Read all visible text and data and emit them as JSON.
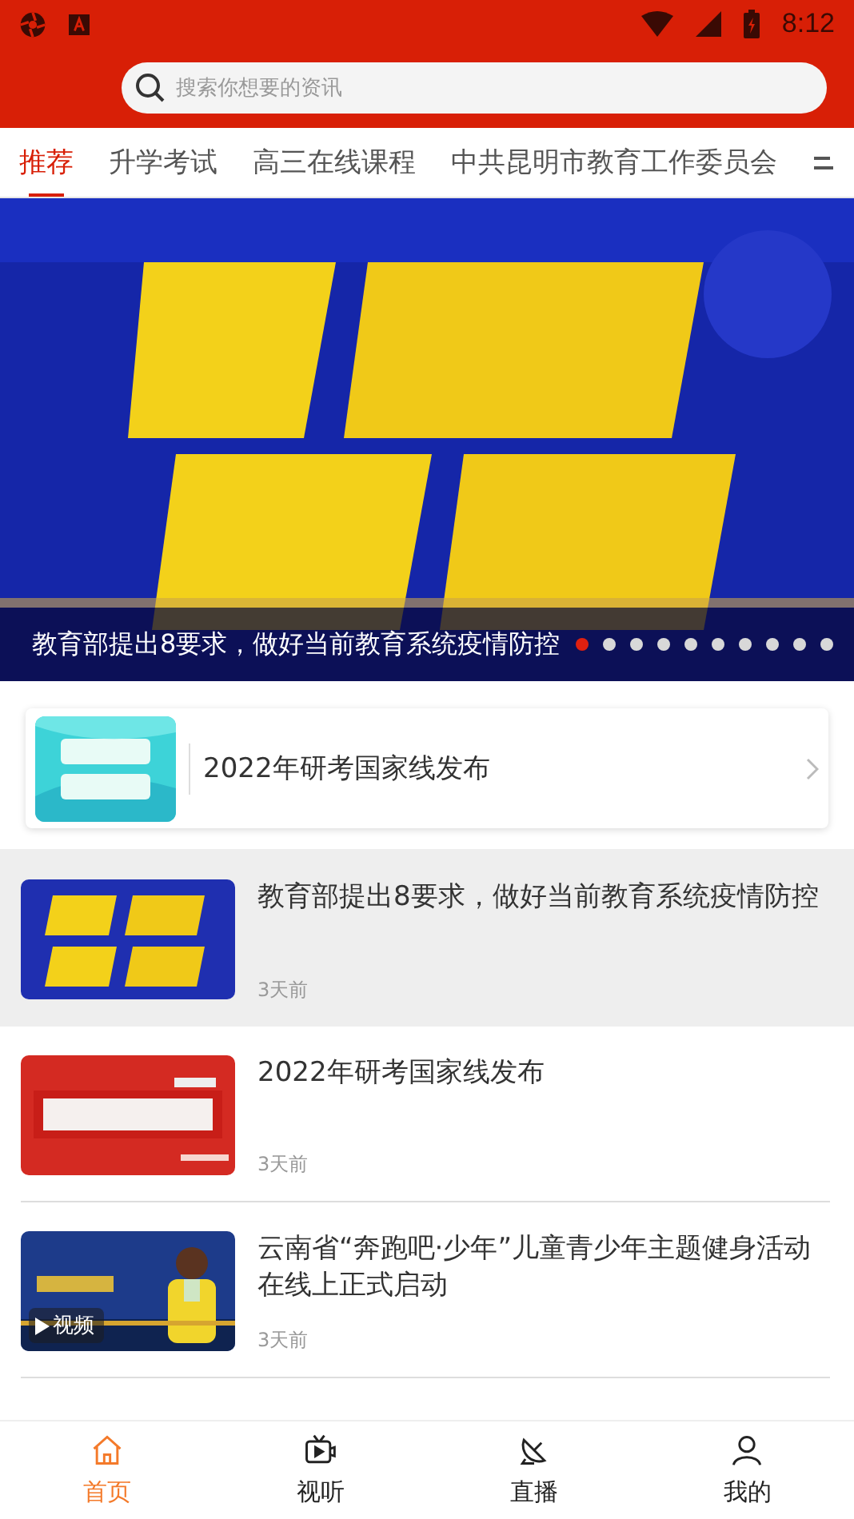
{
  "status_bar": {
    "time": "8:12"
  },
  "search": {
    "placeholder": "搜索你想要的资讯"
  },
  "tabs": [
    {
      "label": "推荐",
      "selected": true
    },
    {
      "label": "升学考试",
      "selected": false
    },
    {
      "label": "高三在线课程",
      "selected": false
    },
    {
      "label": "中共昆明市教育工作委员会",
      "selected": false
    }
  ],
  "banner": {
    "caption": "教育部提出8要求，做好当前教育系统疫情防控",
    "dots": [
      {
        "selected": true
      },
      {
        "selected": false
      },
      {
        "selected": false
      },
      {
        "selected": false
      },
      {
        "selected": false
      },
      {
        "selected": false
      },
      {
        "selected": false
      },
      {
        "selected": false
      },
      {
        "selected": false
      },
      {
        "selected": false
      }
    ]
  },
  "notice": {
    "text": "2022年研考国家线发布"
  },
  "articles": [
    {
      "title": "教育部提出8要求，做好当前教育系统疫情防控",
      "time": "3天前",
      "highlighted": true,
      "kind": "article"
    },
    {
      "title": "2022年研考国家线发布",
      "time": "3天前",
      "highlighted": false,
      "kind": "article"
    },
    {
      "title": "云南省“奔跑吧·少年”儿童青少年主题健身活动在线上正式启动",
      "time": "3天前",
      "highlighted": false,
      "kind": "video",
      "badge": "视频"
    }
  ],
  "bottom_nav": [
    {
      "label": "首页",
      "selected": true
    },
    {
      "label": "视听",
      "selected": false
    },
    {
      "label": "直播",
      "selected": false
    },
    {
      "label": "我的",
      "selected": false
    }
  ]
}
